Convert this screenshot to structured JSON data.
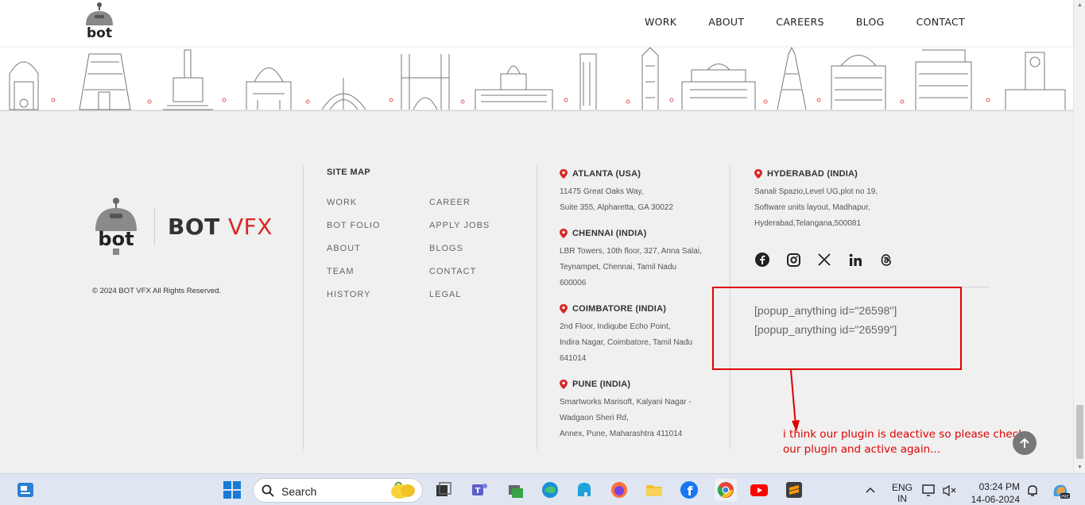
{
  "header": {
    "logo_text": "bot",
    "nav": [
      "WORK",
      "ABOUT",
      "CAREERS",
      "BLOG",
      "CONTACT"
    ]
  },
  "footer": {
    "brand": {
      "bot": "BOT",
      "vfx": "VFX",
      "logo_text": "bot"
    },
    "copyright": "© 2024 BOT VFX All Rights Reserved.",
    "sitemap_title": "SITE MAP",
    "sitemap_col1": [
      "WORK",
      "BOT FOLIO",
      "ABOUT",
      "TEAM",
      "HISTORY"
    ],
    "sitemap_col2": [
      "CAREER",
      "APPLY JOBS",
      "BLOGS",
      "CONTACT",
      "LEGAL"
    ],
    "offices": [
      {
        "title": "ATLANTA (USA)",
        "lines": [
          "11475 Great Oaks Way,",
          "Suite 355, Alpharetta, GA 30022"
        ]
      },
      {
        "title": "CHENNAI (INDIA)",
        "lines": [
          "LBR Towers, 10th floor, 327, Anna Salai,",
          "Teynampet, Chennai, Tamil Nadu",
          "600006"
        ]
      },
      {
        "title": "COIMBATORE (INDIA)",
        "lines": [
          "2nd Floor, Indiqube Echo Point,",
          "Indira Nagar, Coimbatore, Tamil Nadu",
          "641014"
        ]
      },
      {
        "title": "PUNE (INDIA)",
        "lines": [
          "Smartworks Marisoft, Kalyani Nagar -",
          "Wadgaon Sheri Rd,",
          "Annex, Pune, Maharashtra 411014"
        ]
      },
      {
        "title": "HYDERABAD (INDIA)",
        "lines": [
          "Sanali Spazio,Level UG,plot no 19,",
          "Software units layout, Madhapur,",
          "Hyderabad,Telangana,500081"
        ]
      }
    ],
    "socials": [
      "facebook-icon",
      "instagram-icon",
      "x-icon",
      "linkedin-icon",
      "threads-icon"
    ],
    "shortcodes": [
      "[popup_anything id=\"26598\"]",
      "[popup_anything id=\"26599\"]"
    ]
  },
  "annotation": {
    "color": "#e00000",
    "lines": [
      "i think our plugin is deactive so please check",
      "our plugin and active again..."
    ]
  },
  "taskbar": {
    "search_label": "Search",
    "lang_line1": "ENG",
    "lang_line2": "IN",
    "time": "03:24 PM",
    "date": "14-06-2024"
  },
  "colors": {
    "accent": "#d92727",
    "footer_bg": "#f0f0f0"
  }
}
